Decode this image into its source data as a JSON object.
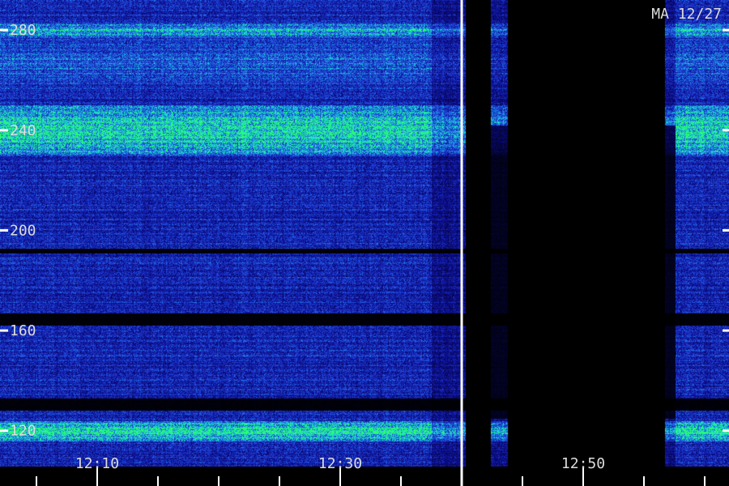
{
  "chart_data": {
    "type": "heatmap",
    "title": "MA 12/27",
    "x": {
      "unit": "time",
      "tick_labels": [
        "12:10",
        "12:30",
        "12:50"
      ],
      "label_minutes": [
        10,
        30,
        50
      ],
      "start_minute": 2,
      "end_minute": 62,
      "minor_tick_interval_minutes": 5
    },
    "y": {
      "tick_labels": [
        "120",
        "160",
        "200",
        "240",
        "280"
      ],
      "tick_values": [
        120,
        160,
        200,
        240,
        280
      ],
      "range": [
        106,
        292
      ]
    },
    "colormap": [
      "#000000",
      "#0b0b8a",
      "#1f3fd8",
      "#1e90e6",
      "#18e6c8",
      "#2bff6a"
    ],
    "bright_bands": [
      {
        "center": 240,
        "width": 10,
        "level": 0.95
      },
      {
        "center": 280,
        "width": 3,
        "level": 0.75
      },
      {
        "center": 120,
        "width": 4,
        "level": 1.0
      },
      {
        "center": 268,
        "width": 16,
        "level": 0.5
      }
    ],
    "dark_bands": [
      {
        "from": 128,
        "to": 133
      },
      {
        "from": 162,
        "to": 167
      },
      {
        "from": 191,
        "to": 193
      }
    ],
    "gaps": [
      {
        "from_minute": 40.3,
        "to_minute": 42.4
      },
      {
        "from_minute": 43.8,
        "to_minute": 56.7
      }
    ],
    "gap_shoulders": [
      {
        "from_minute": 42.4,
        "to_minute": 43.8,
        "level": 0.35
      },
      {
        "from_minute": 56.7,
        "to_minute": 57.6,
        "level": 0.35
      }
    ],
    "marker_minute": 40
  }
}
